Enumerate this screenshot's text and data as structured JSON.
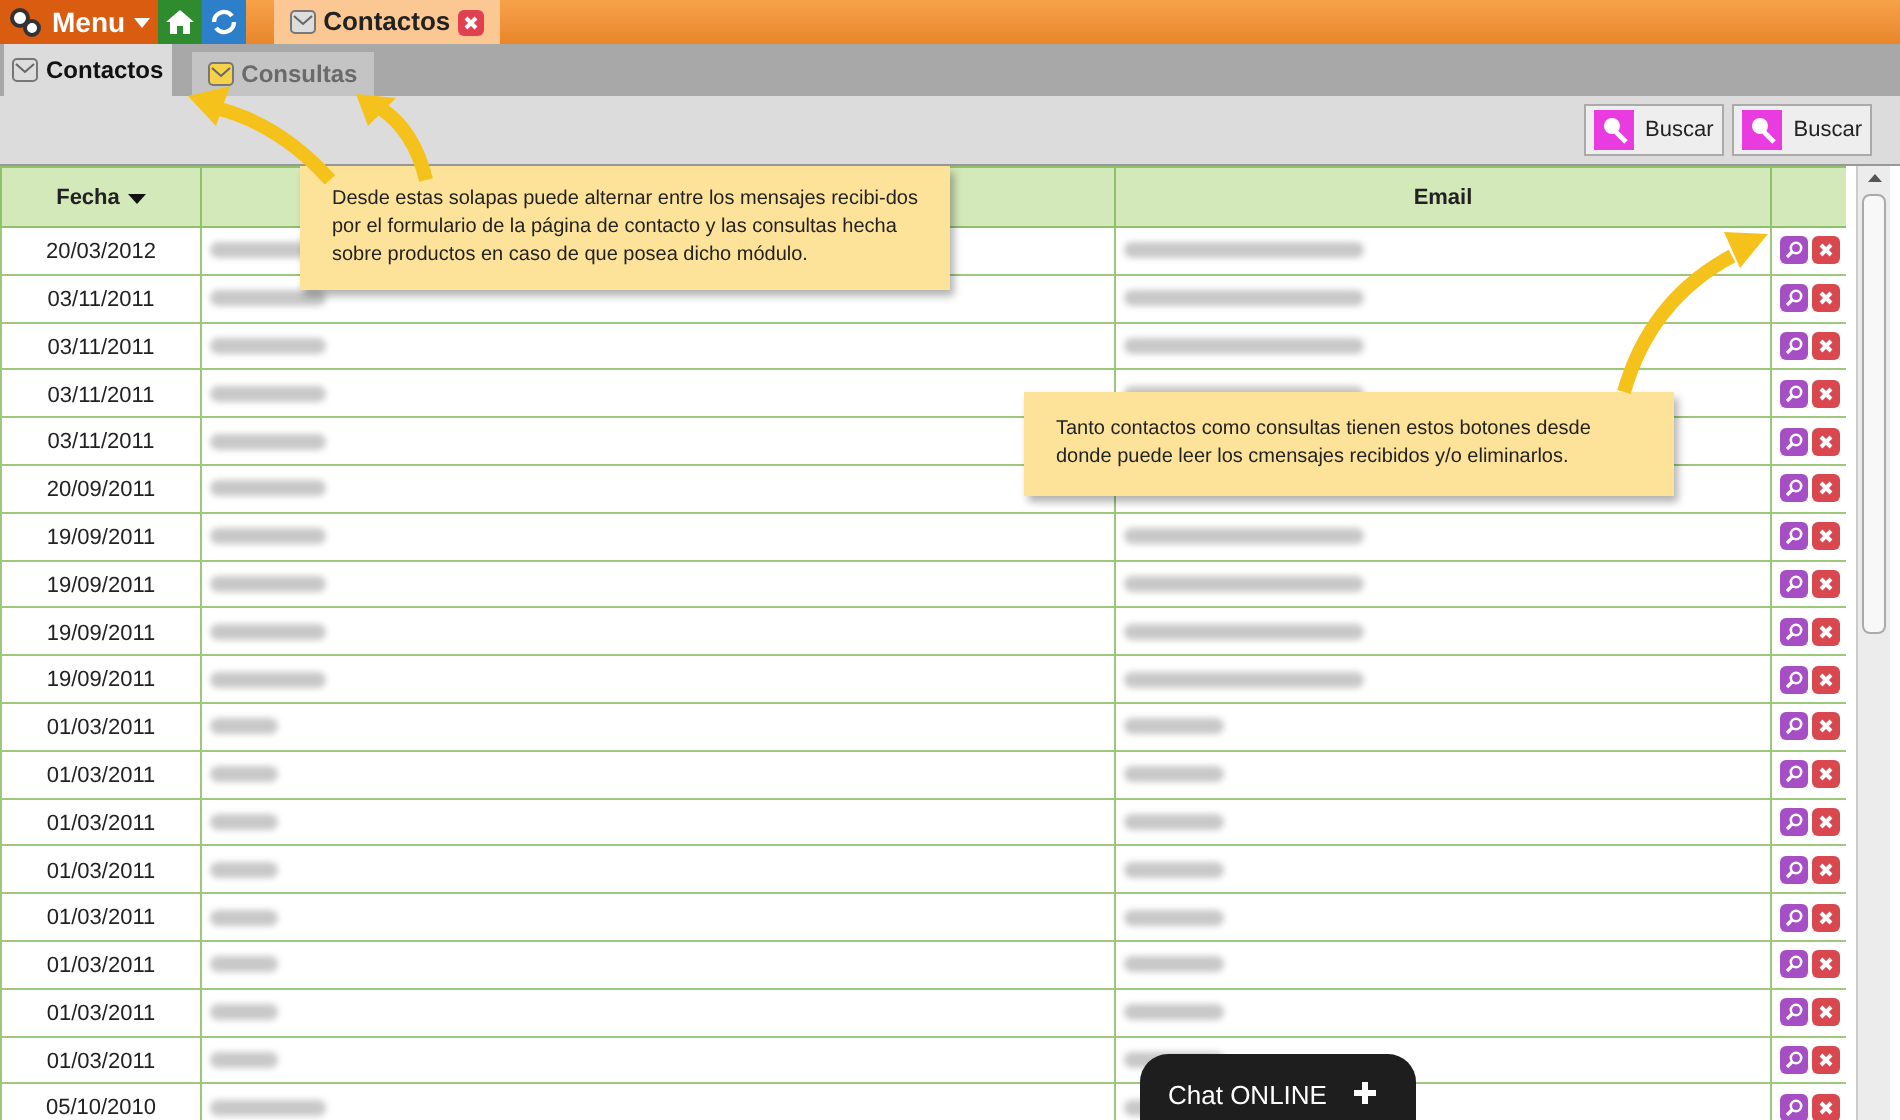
{
  "topbar": {
    "menu": "Menu",
    "open_tab": "Contactos"
  },
  "tabs": [
    {
      "label": "Contactos",
      "selected": true
    },
    {
      "label": "Consultas",
      "selected": false
    }
  ],
  "toolbar": {
    "buttons": [
      "Buscar",
      "Buscar"
    ]
  },
  "table": {
    "columns": [
      {
        "label": "Fecha",
        "sorted": true
      },
      {},
      {
        "label": "Email"
      },
      {}
    ],
    "rows": [
      {
        "date": "20/03/2012"
      },
      {
        "date": "03/11/2011"
      },
      {
        "date": "03/11/2011"
      },
      {
        "date": "03/11/2011"
      },
      {
        "date": "03/11/2011"
      },
      {
        "date": "20/09/2011"
      },
      {
        "date": "19/09/2011"
      },
      {
        "date": "19/09/2011"
      },
      {
        "date": "19/09/2011"
      },
      {
        "date": "19/09/2011"
      },
      {
        "date": "01/03/2011"
      },
      {
        "date": "01/03/2011"
      },
      {
        "date": "01/03/2011"
      },
      {
        "date": "01/03/2011"
      },
      {
        "date": "01/03/2011"
      },
      {
        "date": "01/03/2011"
      },
      {
        "date": "01/03/2011"
      },
      {
        "date": "01/03/2011"
      },
      {
        "date": "05/10/2010"
      }
    ]
  },
  "callouts": [
    "Desde estas solapas puede alternar entre los mensajes recibi-dos por el formulario de la página de contacto y las consultas hecha sobre productos en caso de que posea dicho módulo.",
    "Tanto contactos como consultas tienen estos botones desde donde puede leer los cmensajes recibidos y/o eliminarlos."
  ],
  "chat": {
    "label": "Chat ONLINE"
  }
}
